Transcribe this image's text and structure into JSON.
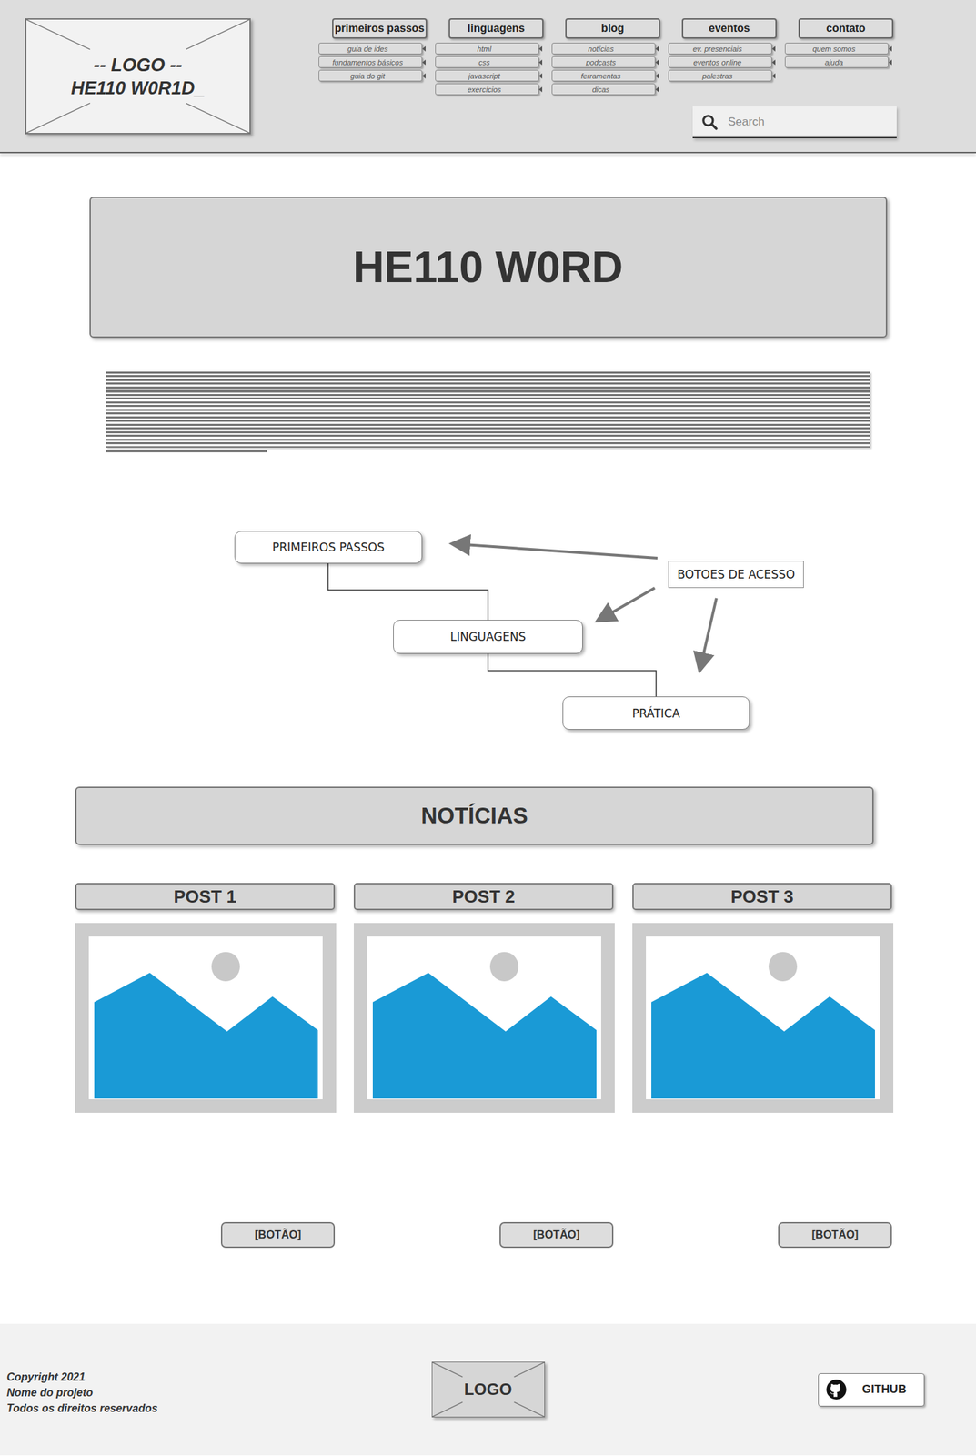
{
  "logo": {
    "line1": "-- LOGO --",
    "line2": "HE110 W0R1D_"
  },
  "nav": [
    {
      "label": "primeiros passos",
      "items": [
        "guia de ides",
        "fundamentos básicos",
        "guia do git"
      ]
    },
    {
      "label": "linguagens",
      "items": [
        "html",
        "css",
        "javascript",
        "exercícios"
      ]
    },
    {
      "label": "blog",
      "items": [
        "notícias",
        "podcasts",
        "ferramentas",
        "dicas"
      ]
    },
    {
      "label": "eventos",
      "items": [
        "ev. presenciais",
        "eventos online",
        "palestras"
      ]
    },
    {
      "label": "contato",
      "items": [
        "quem somos",
        "ajuda"
      ]
    }
  ],
  "search": {
    "placeholder": "Search"
  },
  "hero": {
    "title": "HE110 W0RD"
  },
  "diagram": {
    "nodes": [
      "PRIMEIROS PASSOS",
      "LINGUAGENS",
      "PRÁTICA"
    ],
    "annotation": "BOTOES DE ACESSO"
  },
  "news": {
    "title": "NOTÍCIAS",
    "posts": [
      {
        "title": "POST 1",
        "button": "[BOTÃO]"
      },
      {
        "title": "POST 2",
        "button": "[BOTÃO]"
      },
      {
        "title": "POST 3",
        "button": "[BOTÃO]"
      }
    ]
  },
  "footer": {
    "copyright": [
      "Copyright 2021",
      "Nome do projeto",
      "Todos os direitos reservados"
    ],
    "logo": "LOGO",
    "github": "GITHUB"
  }
}
